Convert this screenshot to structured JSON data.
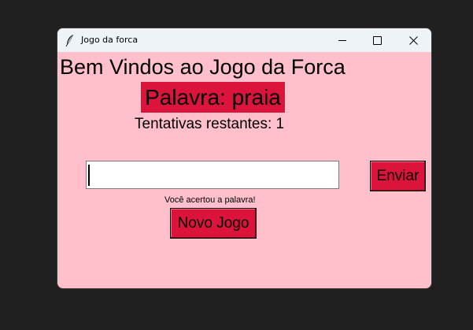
{
  "window": {
    "title": "Jogo da forca",
    "icon": "feather-icon",
    "background": "#ffc0cb"
  },
  "game": {
    "heading": "Bem Vindos ao Jogo da Forca",
    "word_label": "Palavra: praia",
    "attempts_label": "Tentativas restantes: 1",
    "guess_value": "",
    "send_button": "Enviar",
    "message": "Você acertou a palavra!",
    "new_game_button": "Novo Jogo",
    "accent": "#dc143c"
  }
}
